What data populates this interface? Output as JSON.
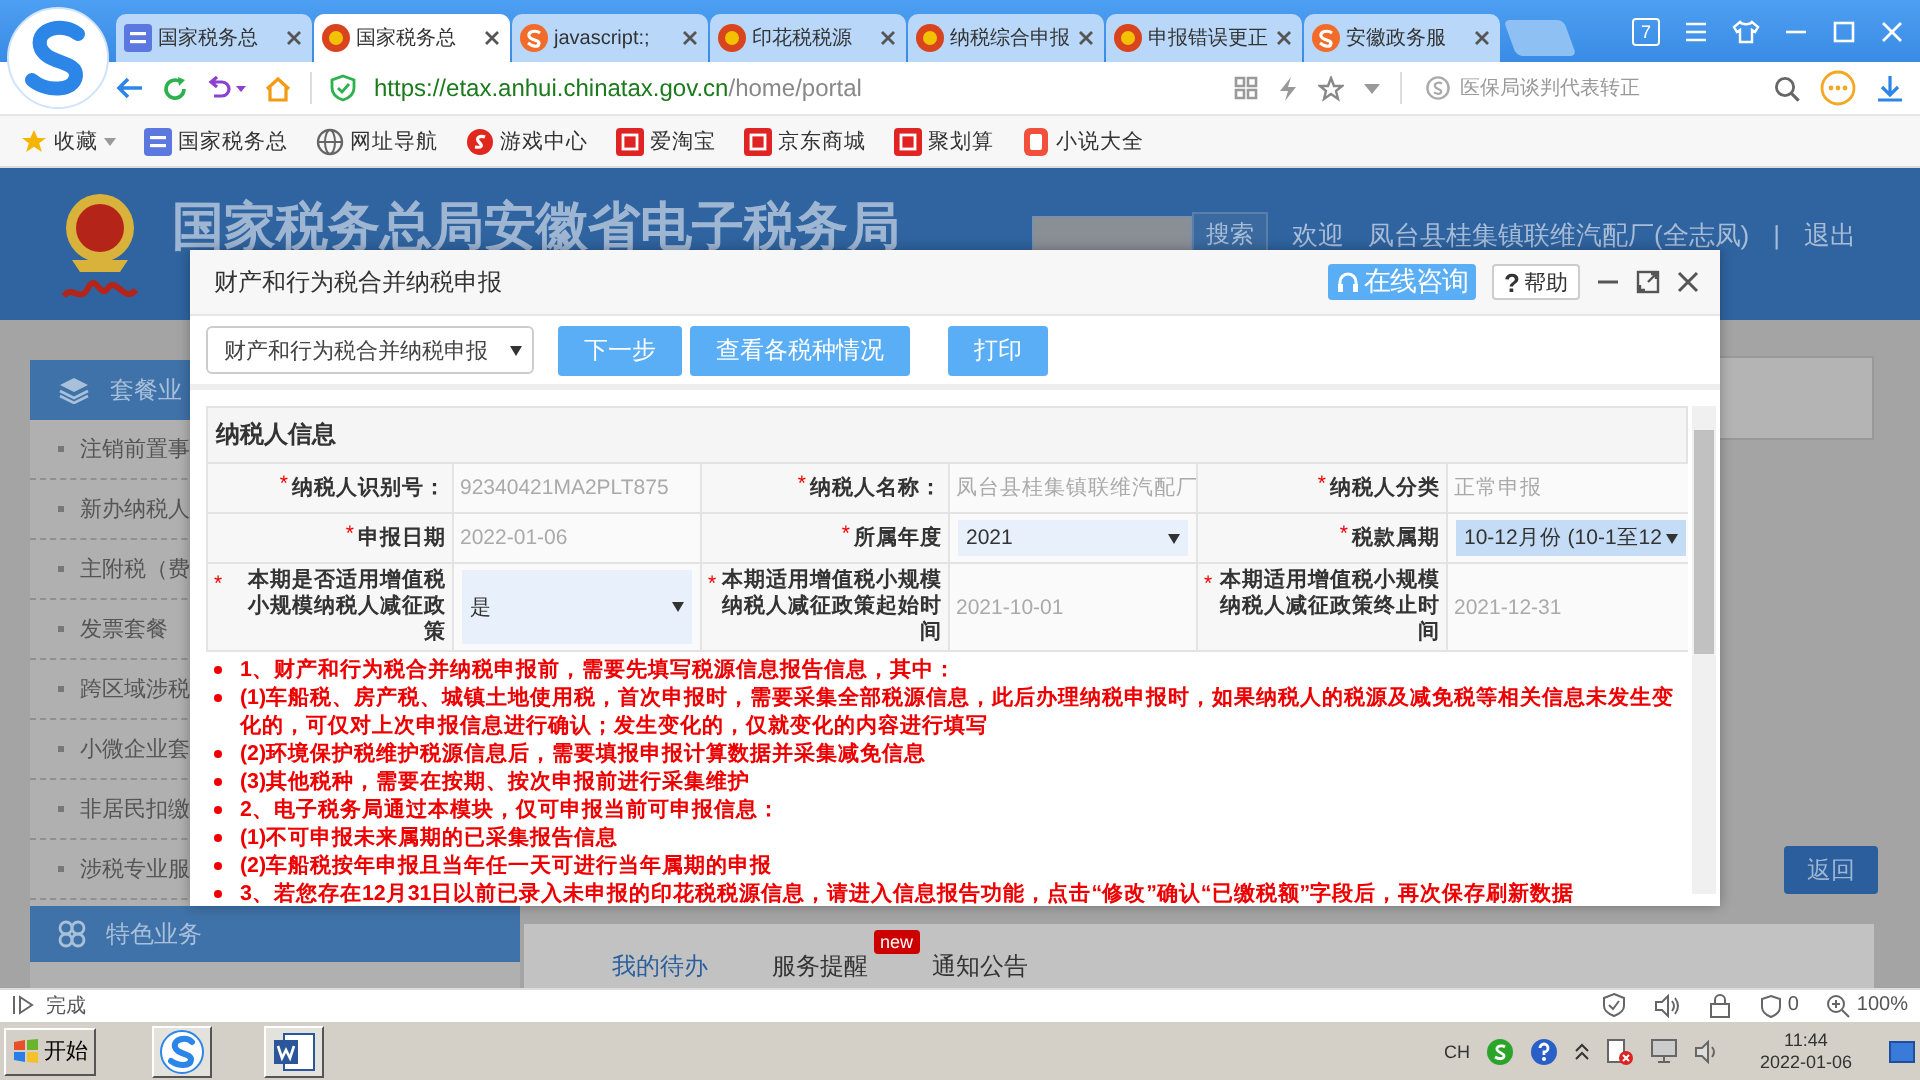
{
  "browser": {
    "tabs": [
      {
        "kind": "site",
        "title": "国家税务总",
        "selected": false
      },
      {
        "kind": "emblem",
        "title": "国家税务总",
        "selected": true
      },
      {
        "kind": "circle-logo",
        "title": "javascript:;",
        "selected": false
      },
      {
        "kind": "emblem",
        "title": "印花税税源",
        "selected": false
      },
      {
        "kind": "emblem",
        "title": "纳税综合申报",
        "selected": false
      },
      {
        "kind": "emblem",
        "title": "申报错误更正",
        "selected": false
      },
      {
        "kind": "circle-logo",
        "title": "安徽政务服",
        "selected": false
      }
    ],
    "window_badge": "7",
    "address": {
      "host": "https://etax.anhui.chinatax.gov.cn",
      "path": "/home/portal"
    },
    "search": {
      "placeholder": "医保局谈判代表转正"
    },
    "bookmarks": [
      {
        "kind": "favorites",
        "label": "收藏"
      },
      {
        "kind": "site",
        "label": "国家税务总"
      },
      {
        "kind": "globe",
        "label": "网址导航"
      },
      {
        "kind": "game",
        "label": "游戏中心"
      },
      {
        "kind": "shop",
        "label": "爱淘宝"
      },
      {
        "kind": "shop",
        "label": "京东商城"
      },
      {
        "kind": "shop",
        "label": "聚划算"
      },
      {
        "kind": "book",
        "label": "小说大全"
      }
    ]
  },
  "portal": {
    "title": "国家税务总局安徽省电子税务局",
    "search_button": "搜索",
    "welcome": "欢迎",
    "user": "凤台县桂集镇联维汽配厂(全志凤)",
    "separator": "|",
    "logout": "退出",
    "sidebar": [
      {
        "kind": "layers",
        "title": "套餐业",
        "items": [
          "注销前置事",
          "新办纳税人",
          "主附税（费",
          "发票套餐",
          "跨区域涉税",
          "小微企业套",
          "非居民扣缴",
          "涉税专业服"
        ]
      },
      {
        "kind": "clover",
        "title": "特色业务"
      }
    ],
    "back_button": "返回",
    "tabs": [
      {
        "label": "我的待办",
        "selected": true
      },
      {
        "label": "服务提醒",
        "selected": false,
        "badge": "new"
      },
      {
        "label": "通知公告",
        "selected": false
      }
    ]
  },
  "dialog": {
    "title": "财产和行为税合并纳税申报",
    "consult_button": "在线咨询",
    "help_glyph": "?",
    "help_button": "帮助",
    "toolbar": {
      "select": "财产和行为税合并纳税申报",
      "buttons": [
        "下一步",
        "查看各税种情况",
        "打印"
      ]
    },
    "section_title": "纳税人信息",
    "rows": [
      {
        "cells": [
          {
            "kind": "label",
            "required_mark": "*",
            "text": "纳税人识别号："
          },
          {
            "kind": "value",
            "text": "92340421MA2PLT875"
          },
          {
            "kind": "label",
            "required_mark": "*",
            "text": "纳税人名称："
          },
          {
            "kind": "value",
            "text": "凤台县桂集镇联维汽配厂"
          },
          {
            "kind": "label",
            "required_mark": "*",
            "text": "纳税人分类"
          },
          {
            "kind": "value",
            "text": "正常申报"
          }
        ]
      },
      {
        "cells": [
          {
            "kind": "label",
            "required_mark": "*",
            "text": "申报日期"
          },
          {
            "kind": "value",
            "text": "2022-01-06"
          },
          {
            "kind": "label",
            "required_mark": "*",
            "text": "所属年度"
          },
          {
            "kind": "select",
            "value": "2021",
            "focused": false
          },
          {
            "kind": "label",
            "required_mark": "*",
            "text": "税款属期"
          },
          {
            "kind": "select",
            "value": "10-12月份 (10-1至12",
            "focused": true
          }
        ]
      },
      {
        "cells": [
          {
            "kind": "label",
            "required_mark": "*",
            "text": "本期是否适用增值税小规模纳税人减征政策"
          },
          {
            "kind": "select",
            "value": "是",
            "focused": false
          },
          {
            "kind": "label",
            "required_mark": "*",
            "text": "本期适用增值税小规模纳税人减征政策起始时间"
          },
          {
            "kind": "value",
            "text": "2021-10-01"
          },
          {
            "kind": "label",
            "required_mark": "*",
            "text": "本期适用增值税小规模纳税人减征政策终止时间"
          },
          {
            "kind": "value",
            "text": "2021-12-31"
          }
        ]
      }
    ],
    "notices": [
      "1、财产和行为税合并纳税申报前，需要先填写税源信息报告信息，其中：",
      "(1)车船税、房产税、城镇土地使用税，首次申报时，需要采集全部税源信息，此后办理纳税申报时，如果纳税人的税源及减免税等相关信息未发生变化的，可仅对上次申报信息进行确认；发生变化的，仅就变化的内容进行填写",
      "(2)环境保护税维护税源信息后，需要填报申报计算数据并采集减免信息",
      "(3)其他税种，需要在按期、按次申报前进行采集维护",
      "2、电子税务局通过本模块，仅可申报当前可申报信息：",
      "(1)不可申报未来属期的已采集报告信息",
      "(2)车船税按年申报且当年任一天可进行当年属期的申报",
      "3、若您存在12月31日以前已录入未申报的印花税税源信息，请进入信息报告功能，点击“修改”确认“已缴税额”字段后，再次保存刷新数据"
    ]
  },
  "status_bar": {
    "text": "完成",
    "blocked_count": "0",
    "zoom": "100%"
  },
  "taskbar": {
    "start": "开始",
    "apps": [
      {
        "kind": "browser"
      },
      {
        "kind": "word"
      }
    ],
    "input": "CH",
    "time": "11:44",
    "date": "2022-01-06"
  }
}
